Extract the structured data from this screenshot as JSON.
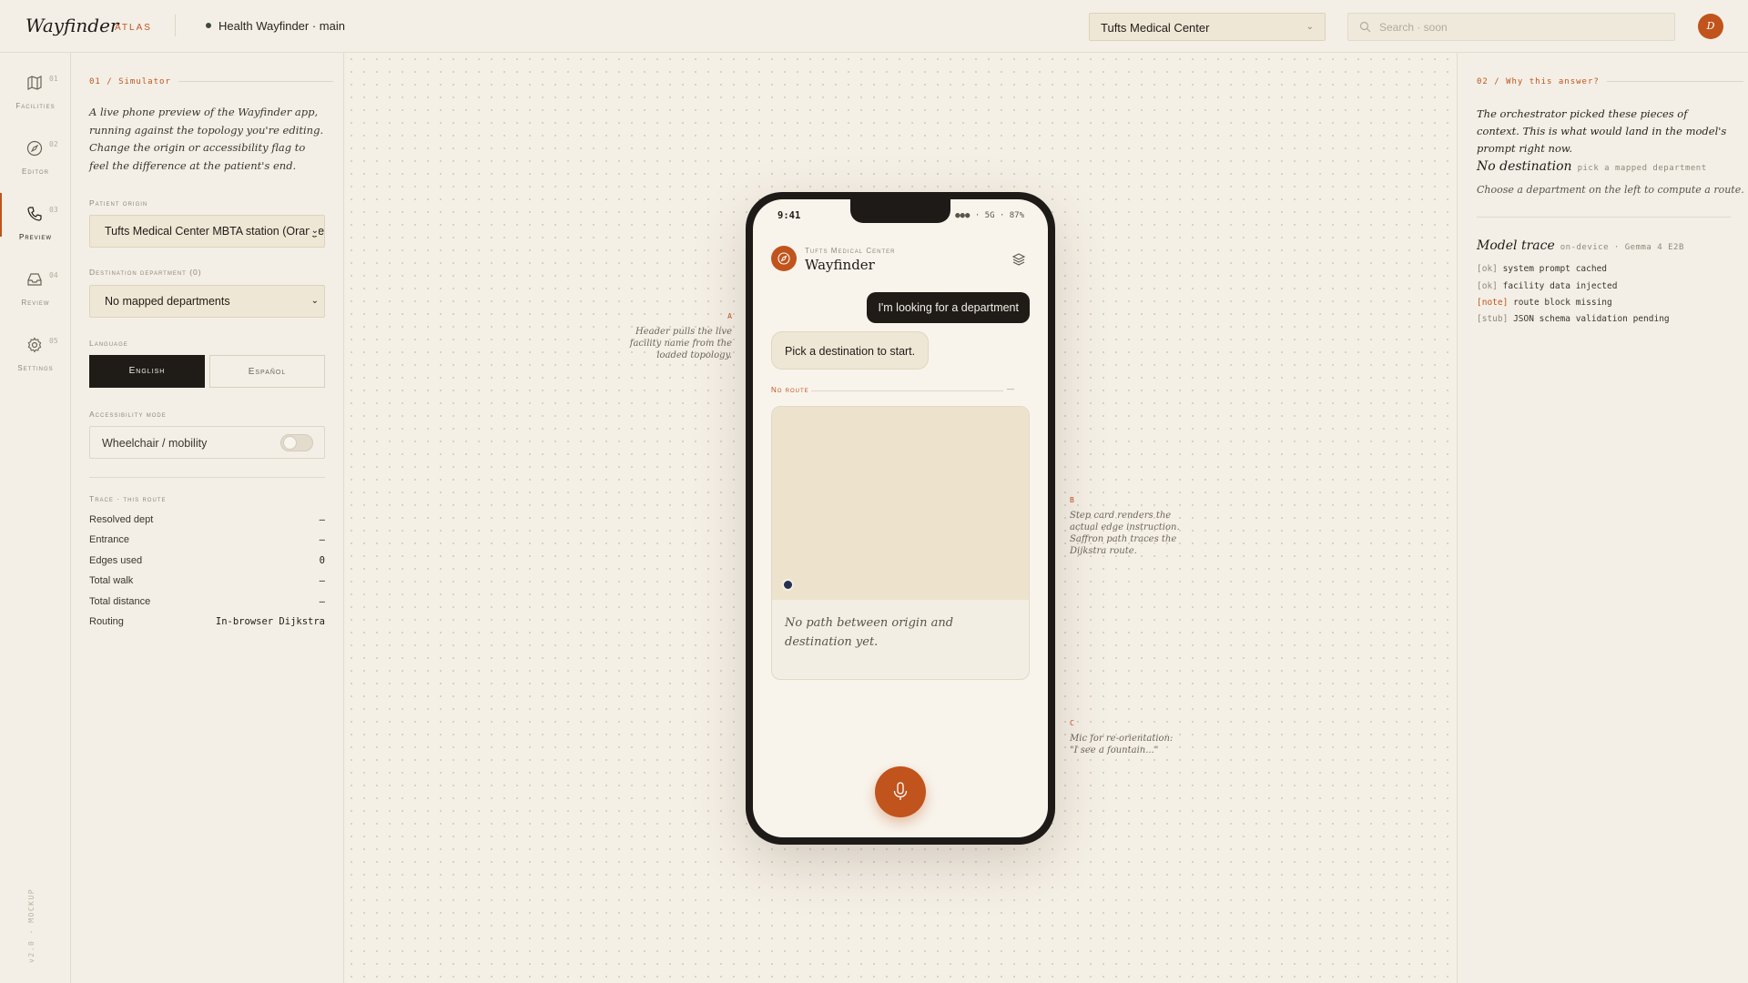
{
  "header": {
    "brand": "Wayfinder",
    "brand_sub": "ATLAS",
    "repo": "Health Wayfinder · main",
    "facility": "Tufts Medical Center",
    "search_placeholder": "Search · soon",
    "avatar_initial": "D"
  },
  "rail": {
    "items": [
      {
        "num": "01",
        "label": "Facilities",
        "icon": "map-icon"
      },
      {
        "num": "02",
        "label": "Editor",
        "icon": "compass-icon"
      },
      {
        "num": "03",
        "label": "Preview",
        "icon": "phone-icon"
      },
      {
        "num": "04",
        "label": "Review",
        "icon": "inbox-icon"
      },
      {
        "num": "05",
        "label": "Settings",
        "icon": "gear-icon"
      }
    ],
    "active": "Preview",
    "version": "v2.0 · MOCKUP"
  },
  "simulator": {
    "heading": "01 / Simulator",
    "lead": "A live phone preview of the Wayfinder app, running against the topology you're editing. Change the origin or accessibility flag to feel the difference at the patient's end.",
    "origin_label": "Patient origin",
    "origin_value": "Tufts Medical Center MBTA station (Orange",
    "destination_label": "Destination department (0)",
    "destination_value": "No mapped departments",
    "language_label": "Language",
    "lang_en": "English",
    "lang_es": "Español",
    "access_label": "Accessibility mode",
    "access_value": "Wheelchair / mobility",
    "trace_label": "Trace · this route",
    "trace": [
      {
        "k": "Resolved dept",
        "v": "—"
      },
      {
        "k": "Entrance",
        "v": "–"
      },
      {
        "k": "Edges used",
        "v": "0"
      },
      {
        "k": "Total walk",
        "v": "—"
      },
      {
        "k": "Total distance",
        "v": "–"
      },
      {
        "k": "Routing",
        "v": "In-browser Dijkstra"
      }
    ]
  },
  "annotations": {
    "a_tag": "A",
    "a_text": "Header pulls the live facility name from the loaded topology.",
    "b_tag": "B",
    "b_text": "Step card renders the actual edge instruction. Saffron path traces the Dijkstra route.",
    "c_tag": "C",
    "c_text": "Mic for re-orientation: \"I see a fountain...\""
  },
  "phone": {
    "time": "9:41",
    "status": "●●● · 5G · 87%",
    "kicker": "Tufts Medical Center",
    "title": "Wayfinder",
    "user_msg": "I'm looking for a department",
    "bot_msg": "Pick a destination to start.",
    "route_label": "No route",
    "route_dash": "—",
    "map_note": "No path between origin and destination yet."
  },
  "why": {
    "heading": "02 / Why this answer?",
    "lead": "The orchestrator picked these pieces of context. This is what would land in the model's prompt right now.",
    "dest_title": "No destination",
    "dest_sub": "pick a mapped department",
    "dest_note": "Choose a department on the left to compute a route.",
    "trace_title": "Model trace",
    "trace_sub": "on-device · Gemma 4 E2B",
    "log": [
      {
        "tag": "[ok]",
        "text": "system prompt cached"
      },
      {
        "tag": "[ok]",
        "text": "facility data injected"
      },
      {
        "tag": "[note]",
        "text": "route block missing"
      },
      {
        "tag": "[stub]",
        "text": "JSON schema validation pending"
      }
    ]
  },
  "colors": {
    "accent": "#c0541c",
    "ink": "#1f1b17",
    "paper": "#f3efe6",
    "pin": "#24304e"
  }
}
